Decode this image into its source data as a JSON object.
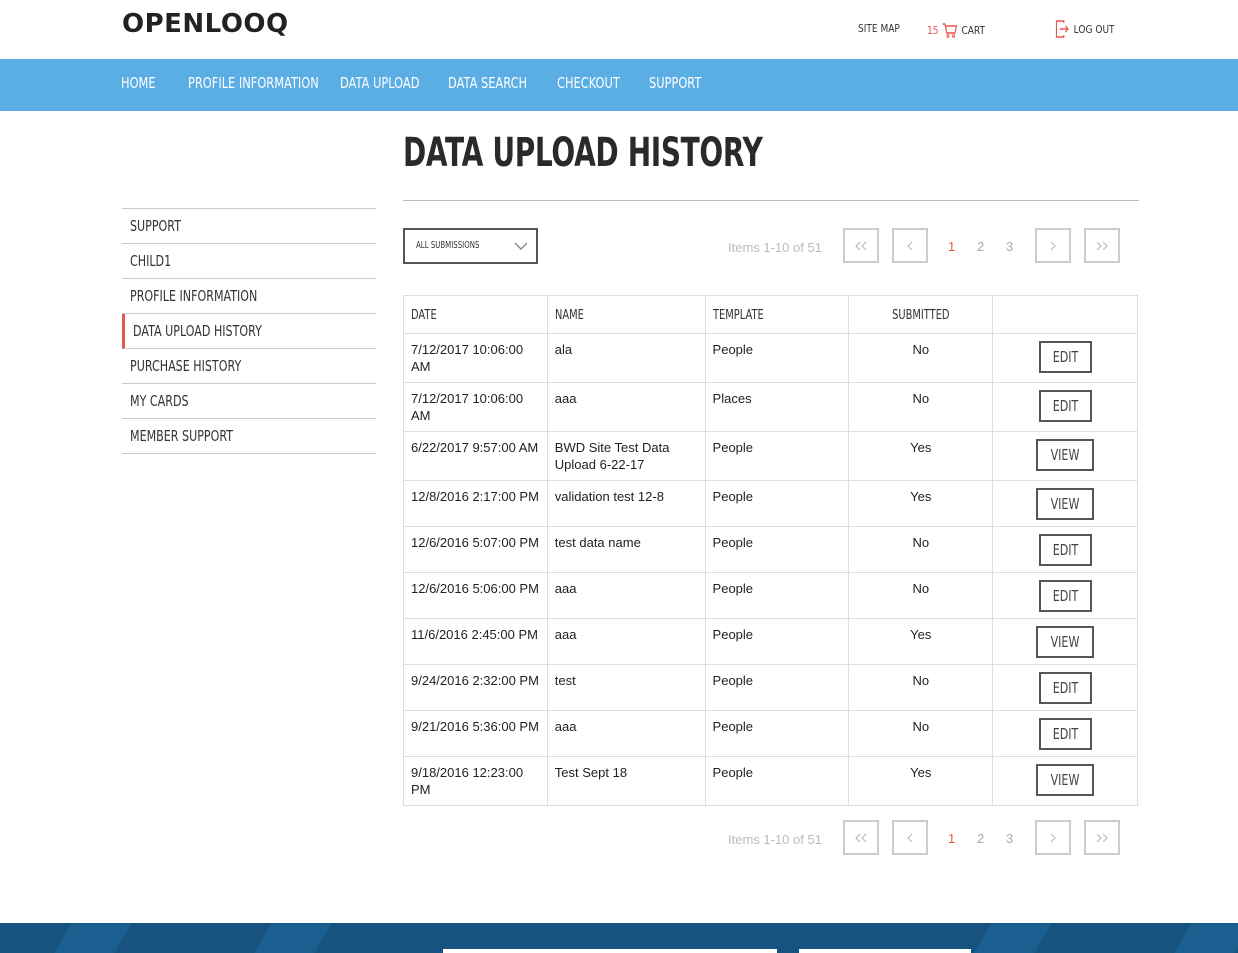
{
  "header": {
    "logo": "OPENLOOQ",
    "site_map": "SITE MAP",
    "cart_count": "15",
    "cart_label": "CART",
    "logout_label": "LOG OUT"
  },
  "nav": [
    "HOME",
    "PROFILE INFORMATION",
    "DATA UPLOAD",
    "DATA SEARCH",
    "CHECKOUT",
    "SUPPORT"
  ],
  "page_title": "DATA UPLOAD HISTORY",
  "sidebar": {
    "items": [
      "SUPPORT",
      "CHILD1",
      "PROFILE INFORMATION",
      "DATA UPLOAD HISTORY",
      "PURCHASE HISTORY",
      "MY CARDS",
      "MEMBER SUPPORT"
    ],
    "active_index": 3
  },
  "filter": {
    "selected": "ALL SUBMISSIONS"
  },
  "pagination": {
    "items_label": "Items 1-10 of 51",
    "first": "«",
    "prev": "‹",
    "pages": [
      "1",
      "2",
      "3"
    ],
    "current": "1",
    "next": "›",
    "last": "»"
  },
  "table": {
    "headers": [
      "DATE",
      "NAME",
      "TEMPLATE",
      "SUBMITTED",
      ""
    ],
    "rows": [
      {
        "date": "7/12/2017 10:06:00 AM",
        "name": "ala",
        "template": "People",
        "submitted": "No",
        "action": "EDIT"
      },
      {
        "date": "7/12/2017 10:06:00 AM",
        "name": "aaa",
        "template": "Places",
        "submitted": "No",
        "action": "EDIT"
      },
      {
        "date": "6/22/2017 9:57:00 AM",
        "name": "BWD Site Test Data Upload 6-22-17",
        "template": "People",
        "submitted": "Yes",
        "action": "VIEW"
      },
      {
        "date": "12/8/2016 2:17:00 PM",
        "name": "validation test 12-8",
        "template": "People",
        "submitted": "Yes",
        "action": "VIEW"
      },
      {
        "date": "12/6/2016 5:07:00 PM",
        "name": "test data name",
        "template": "People",
        "submitted": "No",
        "action": "EDIT"
      },
      {
        "date": "12/6/2016 5:06:00 PM",
        "name": "aaa",
        "template": "People",
        "submitted": "No",
        "action": "EDIT"
      },
      {
        "date": "11/6/2016 2:45:00 PM",
        "name": "aaa",
        "template": "People",
        "submitted": "Yes",
        "action": "VIEW"
      },
      {
        "date": "9/24/2016 2:32:00 PM",
        "name": "test",
        "template": "People",
        "submitted": "No",
        "action": "EDIT"
      },
      {
        "date": "9/21/2016 5:36:00 PM",
        "name": "aaa",
        "template": "People",
        "submitted": "No",
        "action": "EDIT"
      },
      {
        "date": "9/18/2016 12:23:00 PM",
        "name": "Test Sept 18",
        "template": "People",
        "submitted": "Yes",
        "action": "VIEW"
      }
    ]
  },
  "colors": {
    "accent": "#e5554f",
    "nav_bg": "#5aaee4",
    "footer_bg": "#17537f"
  }
}
